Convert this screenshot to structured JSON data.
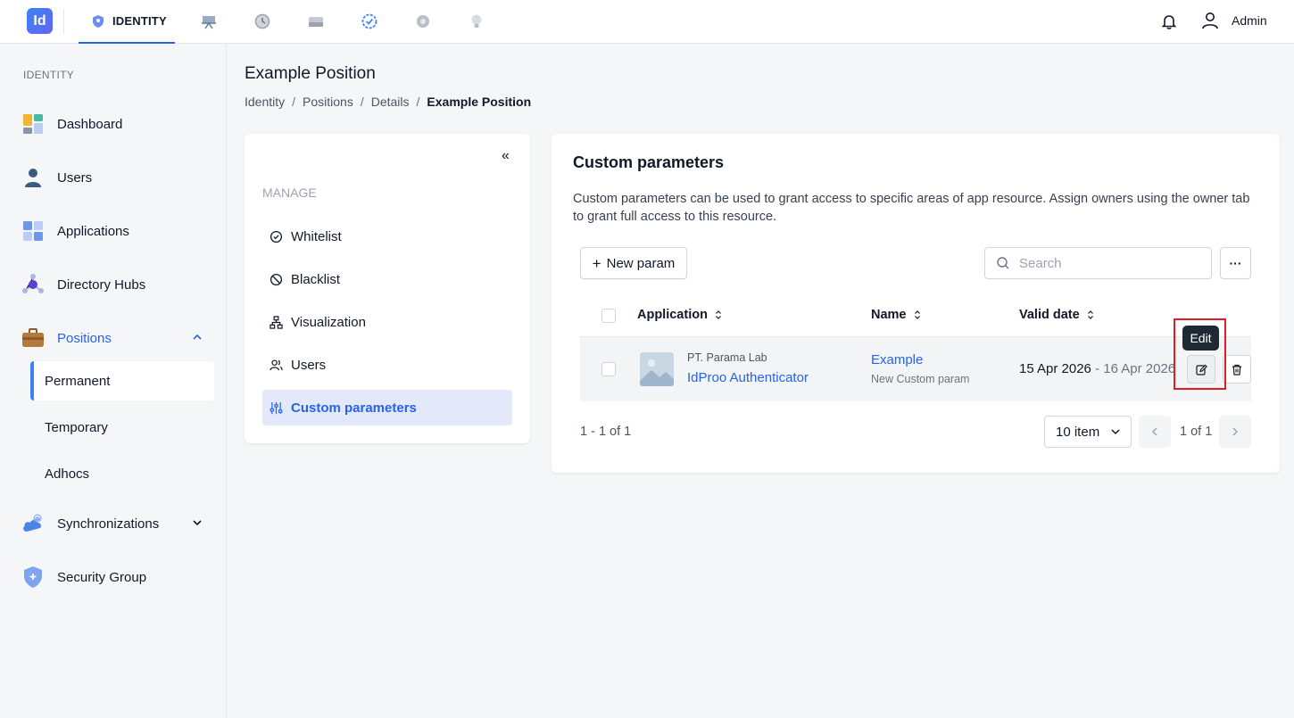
{
  "topbar": {
    "logo_text": "Id",
    "active_module": "IDENTITY",
    "user_name": "Admin"
  },
  "sidebar": {
    "section_title": "IDENTITY",
    "items": [
      {
        "label": "Dashboard",
        "icon": "dashboard-icon"
      },
      {
        "label": "Users",
        "icon": "user-icon"
      },
      {
        "label": "Applications",
        "icon": "applications-icon"
      },
      {
        "label": "Directory Hubs",
        "icon": "directory-hub-icon"
      },
      {
        "label": "Positions",
        "icon": "briefcase-icon",
        "expanded": true
      },
      {
        "label": "Synchronizations",
        "icon": "cloud-sync-icon"
      },
      {
        "label": "Security Group",
        "icon": "shield-icon"
      }
    ],
    "position_subitems": [
      "Permanent",
      "Temporary",
      "Adhocs"
    ]
  },
  "page": {
    "title": "Example Position",
    "breadcrumb": [
      "Identity",
      "Positions",
      "Details",
      "Example Position"
    ]
  },
  "manage": {
    "title": "MANAGE",
    "collapse_glyph": "«",
    "items": [
      {
        "label": "Whitelist",
        "icon": "check-circle-icon"
      },
      {
        "label": "Blacklist",
        "icon": "ban-icon"
      },
      {
        "label": "Visualization",
        "icon": "hierarchy-icon"
      },
      {
        "label": "Users",
        "icon": "users-icon"
      },
      {
        "label": "Custom parameters",
        "icon": "sliders-icon",
        "active": true
      }
    ]
  },
  "custom_params": {
    "title": "Custom parameters",
    "description": "Custom parameters can be used to grant access to specific areas of app resource. Assign owners using the owner tab to grant full access to this resource.",
    "new_button": "New param",
    "search_placeholder": "Search",
    "more_glyph": "···",
    "columns": [
      "Application",
      "Name",
      "Valid date"
    ],
    "rows": [
      {
        "company": "PT. Parama Lab",
        "application": "IdProo Authenticator",
        "name": "Example",
        "name_sub": "New Custom param",
        "valid_start": "15 Apr 2026",
        "valid_end": "- 16 Apr 2026"
      }
    ],
    "tooltip": "Edit",
    "range_text": "1 - 1 of 1",
    "page_size": "10 item",
    "page_text": "1 of 1"
  },
  "colors": {
    "accent": "#2563eb",
    "highlight": "#e11d24",
    "active_bg": "#e4e8fb"
  }
}
